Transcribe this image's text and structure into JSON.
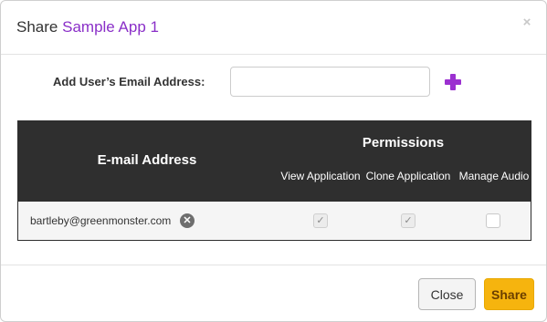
{
  "dialog": {
    "title_prefix": "Share",
    "app_name": "Sample App 1",
    "close_glyph": "×"
  },
  "email_form": {
    "label": "Add User’s Email Address:",
    "input_value": "",
    "add_icon": "plus-icon"
  },
  "table": {
    "email_header": "E-mail Address",
    "permissions_header": "Permissions",
    "columns": [
      "View Application",
      "Clone Application",
      "Manage Audio"
    ],
    "rows": [
      {
        "email": "bartleby@greenmonster.com",
        "view_application": true,
        "clone_application": true,
        "manage_audio": false
      }
    ]
  },
  "footer": {
    "close_label": "Close",
    "share_label": "Share"
  },
  "colors": {
    "accent_purple": "#8a2fc8",
    "header_dark": "#2f2f2f",
    "share_button": "#f6b40e"
  }
}
